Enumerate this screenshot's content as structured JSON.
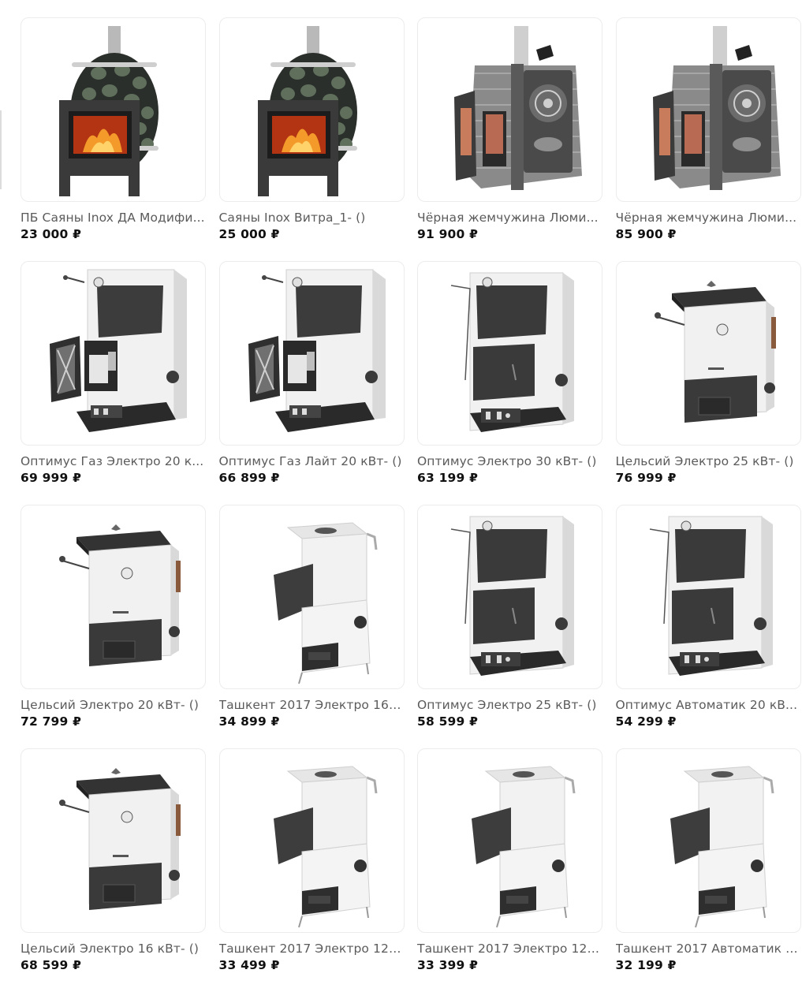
{
  "products": [
    {
      "name": "ПБ Саяны Inox ДА Модифи...",
      "price": "23 000 ₽",
      "image": "barrel-sauna-stove"
    },
    {
      "name": "Саяны Inox Витра_1- ()",
      "price": "25 000 ₽",
      "image": "barrel-sauna-stove"
    },
    {
      "name": "Чёрная жемчужина Люми...",
      "price": "91 900 ₽",
      "image": "mesh-sauna-stove"
    },
    {
      "name": "Чёрная жемчужина Люми...",
      "price": "85 900 ₽",
      "image": "mesh-sauna-stove"
    },
    {
      "name": "Оптимус Газ Электро 20 к...",
      "price": "69 999 ₽",
      "image": "boiler-open-burner"
    },
    {
      "name": "Оптимус Газ Лайт 20 кВт- ()",
      "price": "66 899 ₽",
      "image": "boiler-open-burner"
    },
    {
      "name": "Оптимус Электро 30 кВт- ()",
      "price": "63 199 ₽",
      "image": "boiler-closed"
    },
    {
      "name": "Цельсий Электро 25 кВт- ()",
      "price": "76 999 ₽",
      "image": "boiler-celsius"
    },
    {
      "name": "Цельсий Электро 20 кВт- ()",
      "price": "72 799 ₽",
      "image": "boiler-celsius"
    },
    {
      "name": "Ташкент 2017 Электро 16 ...",
      "price": "34 899 ₽",
      "image": "boiler-tashkent"
    },
    {
      "name": "Оптимус Электро 25 кВт- ()",
      "price": "58 599 ₽",
      "image": "boiler-closed"
    },
    {
      "name": "Оптимус Автоматик 20 кВ...",
      "price": "54 299 ₽",
      "image": "boiler-closed"
    },
    {
      "name": "Цельсий Электро 16 кВт- ()",
      "price": "68 599 ₽",
      "image": "boiler-celsius"
    },
    {
      "name": "Ташкент 2017 Электро 12 ...",
      "price": "33 499 ₽",
      "image": "boiler-tashkent"
    },
    {
      "name": "Ташкент 2017 Электро 12 ...",
      "price": "33 399 ₽",
      "image": "boiler-tashkent"
    },
    {
      "name": "Ташкент 2017 Автоматик 1...",
      "price": "32 199 ₽",
      "image": "boiler-tashkent"
    }
  ]
}
